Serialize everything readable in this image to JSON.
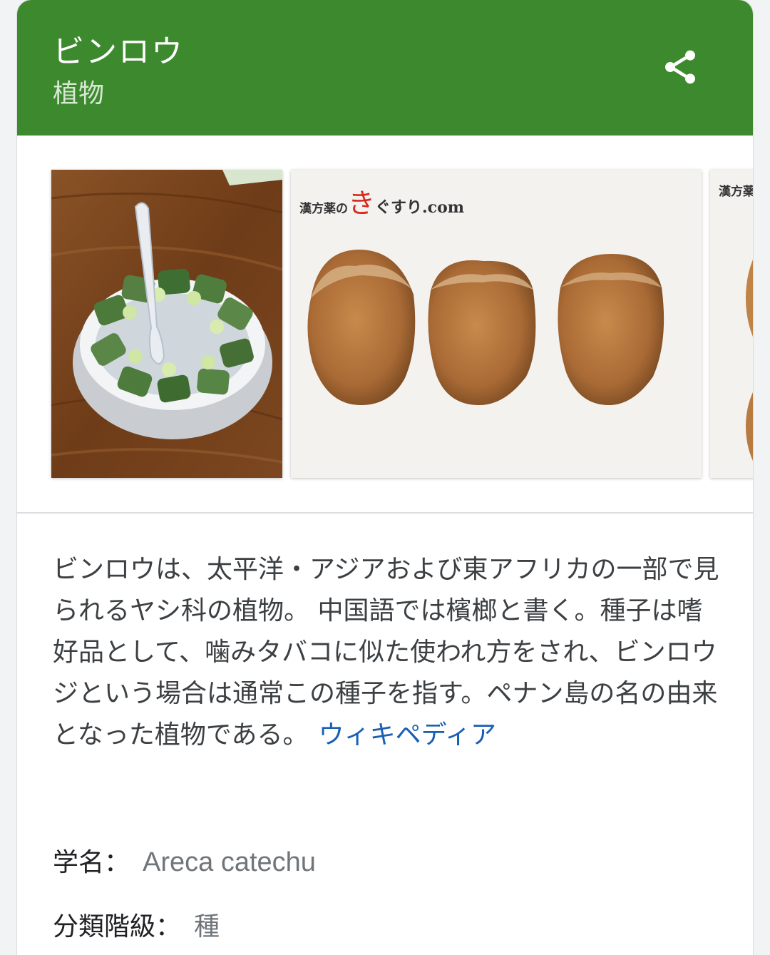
{
  "header": {
    "title": "ビンロウ",
    "subtitle": "植物",
    "bg_color": "#3d8a2e",
    "share_icon": "share-icon"
  },
  "images": [
    {
      "name": "betel-nut-bowl-image"
    },
    {
      "name": "areca-seeds-image",
      "watermark_small": "漢方薬の",
      "watermark_accent": "き",
      "watermark_rest": "ぐすり.com"
    },
    {
      "name": "areca-seeds-image-partial",
      "watermark_small": "漢方薬の"
    }
  ],
  "description": {
    "text": "ビンロウは、太平洋・アジアおよび東アフリカの一部で見られるヤシ科の植物。 中国語では檳榔と書く。種子は嗜好品として、噛みタバコに似た使われ方をされ、ビンロウジという場合は通常この種子を指す。ペナン島の名の由来となった植物である。",
    "link_label": "ウィキペディア",
    "link_color": "#1a5fb4"
  },
  "facts": [
    {
      "label": "学名：",
      "value": "Areca catechu"
    },
    {
      "label": "分類階級：",
      "value": "種"
    }
  ]
}
